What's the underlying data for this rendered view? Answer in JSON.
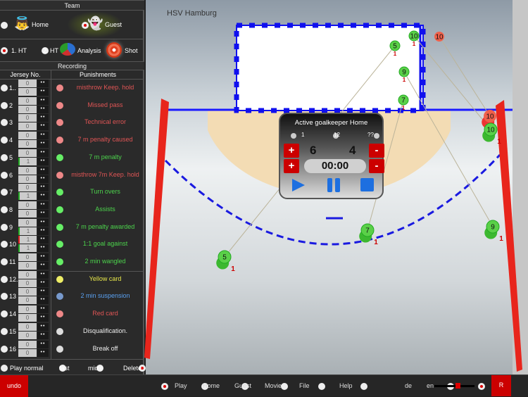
{
  "team": {
    "header": "Team",
    "home": "Home",
    "guest": "Guest",
    "selected": "Guest"
  },
  "half": {
    "ht1": "1. HT",
    "ht2": "2. HT",
    "analysis": "Analysis",
    "shot": "Shot",
    "selected": "1. HT"
  },
  "recording": {
    "header": "Recording",
    "col_jersey": "Jersey No.",
    "col_punishments": "Punishments"
  },
  "players": [
    {
      "no": "1..",
      "a": "0",
      "b": "0"
    },
    {
      "no": "2",
      "a": "0",
      "b": "0"
    },
    {
      "no": "3",
      "a": "0",
      "b": "0"
    },
    {
      "no": "4",
      "a": "0",
      "b": "0"
    },
    {
      "no": "5",
      "a": "0",
      "b": "1"
    },
    {
      "no": "6",
      "a": "0",
      "b": "0"
    },
    {
      "no": "7",
      "a": "0",
      "b": "1"
    },
    {
      "no": "8",
      "a": "0",
      "b": "0"
    },
    {
      "no": "9",
      "a": "0",
      "b": "1"
    },
    {
      "no": "10",
      "a": "1",
      "b": "1"
    },
    {
      "no": "11",
      "a": "0",
      "b": "0"
    },
    {
      "no": "12..",
      "a": "0",
      "b": "0"
    },
    {
      "no": "13",
      "a": "0",
      "b": "0"
    },
    {
      "no": "14",
      "a": "0",
      "b": "0"
    },
    {
      "no": "15",
      "a": "0",
      "b": "0"
    },
    {
      "no": "16",
      "a": "0",
      "b": "0"
    }
  ],
  "punishments": [
    {
      "label": "misthrow Keep. hold",
      "color": "#e05555",
      "dot": "#e88"
    },
    {
      "label": "Missed pass",
      "color": "#e05555",
      "dot": "#e88"
    },
    {
      "label": "Technical error",
      "color": "#e05555",
      "dot": "#e88"
    },
    {
      "label": "7 m penalty caused",
      "color": "#e05555",
      "dot": "#e88"
    },
    {
      "label": "7 m penalty",
      "color": "#4cd34c",
      "dot": "#6e6"
    },
    {
      "label": "misthrow 7m Keep. hold",
      "color": "#e05555",
      "dot": "#e88"
    },
    {
      "label": "Turn overs",
      "color": "#4cd34c",
      "dot": "#6e6"
    },
    {
      "label": "Assists",
      "color": "#4cd34c",
      "dot": "#6e6"
    },
    {
      "label": "7 m penalty awarded",
      "color": "#4cd34c",
      "dot": "#6e6"
    },
    {
      "label": "1:1 goal against",
      "color": "#4cd34c",
      "dot": "#6e6"
    },
    {
      "label": "2 min wangled",
      "color": "#4cd34c",
      "dot": "#6e6"
    },
    {
      "label": "Yellow card",
      "color": "#e8e84a",
      "dot": "#ee6"
    },
    {
      "label": "2 min suspension",
      "color": "#5aa0f0",
      "dot": "#79c"
    },
    {
      "label": "Red card",
      "color": "#e05555",
      "dot": "#e88"
    },
    {
      "label": "Disqualification.",
      "color": "#eeeeee",
      "dot": "#ddd"
    },
    {
      "label": "Break off",
      "color": "#eeeeee",
      "dot": "#ddd"
    }
  ],
  "speed": {
    "normal": "Play normal",
    "fast": "fast",
    "midle": "midle",
    "delete": "Delete",
    "selected": "Delete"
  },
  "court": {
    "team_name": "HSV Hamburg"
  },
  "goalkeeper": {
    "title": "Active goalkeeper Home",
    "options": [
      "1",
      "12",
      "??"
    ],
    "score_home": "6",
    "score_guest": "4",
    "timer": "00:00",
    "plus": "+",
    "minus": "-"
  },
  "shots": [
    {
      "no": "10",
      "count": "1",
      "color": "green"
    },
    {
      "no": "5",
      "count": "1",
      "color": "green"
    },
    {
      "no": "9",
      "count": "1",
      "color": "green"
    },
    {
      "no": "7",
      "count": "1",
      "color": "green"
    },
    {
      "no": "10",
      "count": "",
      "color": "red"
    }
  ],
  "shooters": [
    {
      "no": "5",
      "count": "1",
      "color": "green"
    },
    {
      "no": "7",
      "count": "1",
      "color": "green"
    },
    {
      "no": "9",
      "count": "1",
      "color": "green"
    },
    {
      "no": "10",
      "count": "",
      "color": "red"
    },
    {
      "no": "10",
      "count": "1",
      "color": "green"
    }
  ],
  "bottom": {
    "undo": "undo",
    "play": "Play",
    "home": "Home",
    "guest": "Guest",
    "movie": "Movie",
    "file": "File",
    "help": "Help",
    "de": "de",
    "en": "en",
    "r": "R",
    "volume": 0.6
  }
}
